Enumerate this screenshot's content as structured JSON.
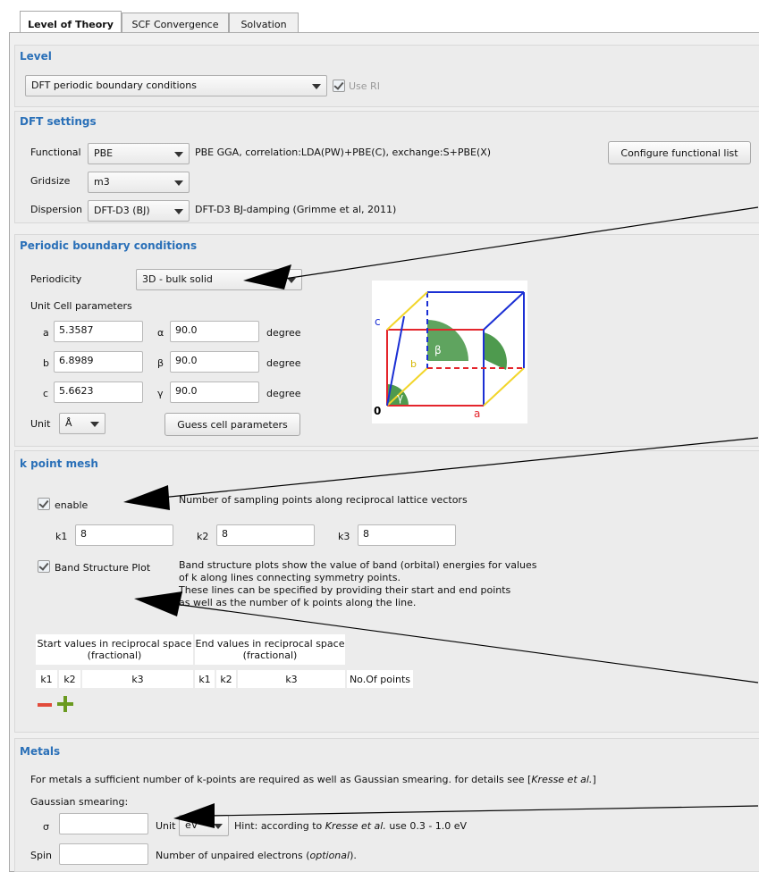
{
  "tabs": [
    {
      "label": "Level of Theory",
      "active": true
    },
    {
      "label": "SCF Convergence",
      "active": false
    },
    {
      "label": "Solvation",
      "active": false
    }
  ],
  "level": {
    "title": "Level",
    "method": "DFT periodic boundary conditions",
    "use_ri_label": "Use RI"
  },
  "dft": {
    "title": "DFT settings",
    "functional_label": "Functional",
    "functional_value": "PBE",
    "functional_desc": "PBE GGA, correlation:LDA(PW)+PBE(C), exchange:S+PBE(X)",
    "configure_button": "Configure functional list",
    "gridsize_label": "Gridsize",
    "gridsize_value": "m3",
    "dispersion_label": "Dispersion",
    "dispersion_value": "DFT-D3 (BJ)",
    "dispersion_desc": "DFT-D3 BJ-damping (Grimme et al, 2011)"
  },
  "pbc": {
    "title": "Periodic boundary conditions",
    "periodicity_label": "Periodicity",
    "periodicity_value": "3D - bulk solid",
    "unit_cell_label": "Unit Cell parameters",
    "a_label": "a",
    "a_value": "5.3587",
    "b_label": "b",
    "b_value": "6.8989",
    "c_label": "c",
    "c_value": "5.6623",
    "alpha_label": "α",
    "alpha_value": "90.0",
    "beta_label": "β",
    "beta_value": "90.0",
    "gamma_label": "γ",
    "gamma_value": "90.0",
    "degree": "degree",
    "unit_label": "Unit",
    "unit_value": "Å",
    "guess_button": "Guess cell parameters",
    "diagram": {
      "c": "c",
      "b": "b",
      "a": "a",
      "origin": "0",
      "alpha": "α",
      "beta": "β",
      "gamma": "γ"
    }
  },
  "kpoint": {
    "title": "k point mesh",
    "enable_label": "enable",
    "sampling_desc": "Number of sampling points along reciprocal lattice vectors",
    "k1_label": "k1",
    "k1_value": "8",
    "k2_label": "k2",
    "k2_value": "8",
    "k3_label": "k3",
    "k3_value": "8",
    "band_label": "Band Structure Plot",
    "band_desc": [
      "Band structure plots show the value of band (orbital) energies for values",
      "of k along lines connecting symmetry points.",
      "These lines can be specified by providing their start and end points",
      "as well as the number of k points along the line."
    ],
    "table": {
      "start_header_1": "Start values in reciprocal space",
      "start_header_2": "(fractional)",
      "end_header_1": "End values in reciprocal space",
      "end_header_2": "(fractional)",
      "columns": [
        "k1",
        "k2",
        "k3",
        "k1",
        "k2",
        "k3",
        "No.Of points"
      ]
    }
  },
  "metals": {
    "title": "Metals",
    "desc_prefix": "For metals a sufficient number of k-points are required as well as Gaussian smearing. for details see [",
    "desc_ref": "Kresse et al.",
    "desc_suffix": "]",
    "gaussian_label": "Gaussian smearing:",
    "sigma_label": "σ",
    "sigma_value": "",
    "unit_label": "Unit",
    "unit_value": "eV",
    "hint_prefix": "Hint: according to ",
    "hint_ref": "Kresse et al.",
    "hint_suffix": " use 0.3 - 1.0 eV",
    "spin_label": "Spin",
    "spin_value": "",
    "spin_desc_prefix": "Number of unpaired electrons (",
    "spin_desc_ref": "optional",
    "spin_desc_suffix": ")."
  },
  "colors": {
    "accent": "#2a70b8",
    "remove": "#e24b3b",
    "add": "#6a9a1f",
    "diagram_green": "#4e9a4e"
  }
}
